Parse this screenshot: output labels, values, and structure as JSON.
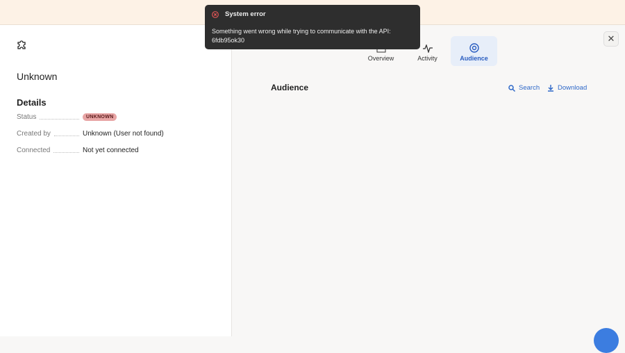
{
  "toast": {
    "title": "System error",
    "message": "Something went wrong while trying to communicate with the API:",
    "code": "6fdb95ok30"
  },
  "left": {
    "name": "Unknown",
    "details_title": "Details",
    "rows": [
      {
        "label": "Status",
        "value": "UNKNOWN"
      },
      {
        "label": "Created by",
        "value": "Unknown (User not found)"
      },
      {
        "label": "Connected",
        "value": "Not yet connected"
      }
    ]
  },
  "tabs": [
    {
      "label": "Overview"
    },
    {
      "label": "Activity"
    },
    {
      "label": "Audience"
    }
  ],
  "main": {
    "section_title": "Audience",
    "search_label": "Search",
    "download_label": "Download"
  },
  "colors": {
    "accent": "#2e68c8",
    "badge": "#e8a5a5"
  }
}
